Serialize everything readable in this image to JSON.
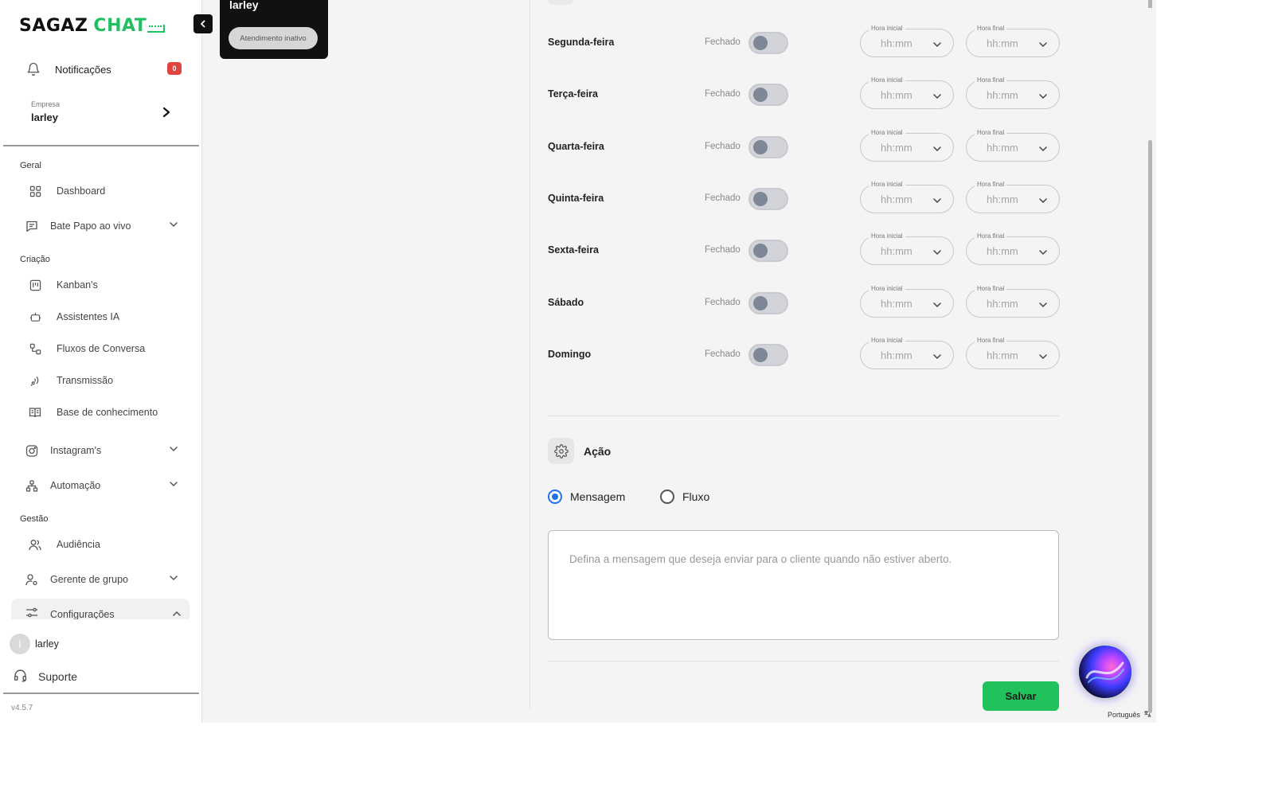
{
  "brand": {
    "name": "SAGAZ",
    "accent": "CHAT",
    "accent_color": "#1fbf62"
  },
  "sidebar": {
    "notifications": {
      "label": "Notificações",
      "count": "0"
    },
    "company": {
      "caption": "Empresa",
      "name": "larley"
    },
    "sections": {
      "geral": "Geral",
      "criacao": "Criação",
      "gestao": "Gestão"
    },
    "items": {
      "dashboard": "Dashboard",
      "bate_papo": "Bate Papo ao vivo",
      "kanbans": "Kanban's",
      "assistentes": "Assistentes IA",
      "fluxos": "Fluxos de Conversa",
      "transmissao": "Transmissão",
      "base": "Base de conhecimento",
      "instagram": "Instagram's",
      "automacao": "Automação",
      "audiencia": "Audiência",
      "gerente": "Gerente de grupo",
      "configuracoes": "Configurações"
    },
    "user": {
      "initial": "l",
      "name": "larley"
    },
    "support": "Suporte",
    "version": "v4.5.7"
  },
  "company_card": {
    "title": "larley",
    "status": "Atendimento inativo"
  },
  "schedule": {
    "closed_label": "Fechado",
    "start_label": "Hora inicial",
    "end_label": "Hora final",
    "time_placeholder": "hh:mm",
    "days": [
      "Segunda-feira",
      "Terça-feira",
      "Quarta-feira",
      "Quinta-feira",
      "Sexta-feira",
      "Sábado",
      "Domingo"
    ]
  },
  "action": {
    "title": "Ação",
    "options": {
      "message": "Mensagem",
      "flow": "Fluxo"
    },
    "selected": "Mensagem",
    "message_placeholder": "Defina a mensagem que deseja enviar para o cliente quando não estiver aberto."
  },
  "save_label": "Salvar",
  "language": "Português"
}
